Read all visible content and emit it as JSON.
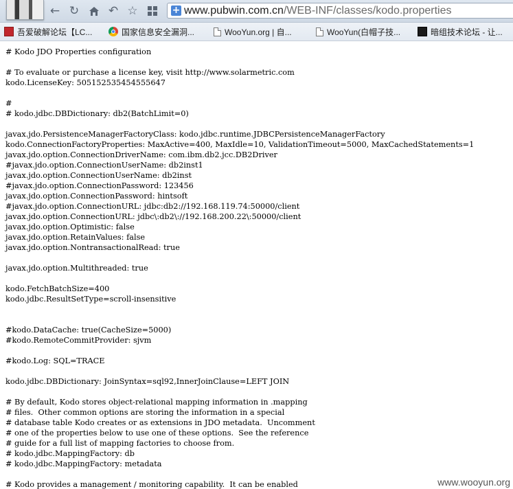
{
  "browser": {
    "address_bar": {
      "url_host": "www.pubwin.com.cn",
      "url_path": "/WEB-INF/classes/kodo.properties"
    },
    "bookmarks": [
      {
        "label": "吾爱破解论坛【LC...",
        "icon": "red-logo-icon"
      },
      {
        "label": "国家信息安全漏洞...",
        "icon": "chrome-icon"
      },
      {
        "label": "WooYun.org | 自...",
        "icon": "page-icon"
      },
      {
        "label": "WooYun(白帽子技...",
        "icon": "page-icon"
      },
      {
        "label": "暗组技术论坛 - 让...",
        "icon": "dark-logo-icon"
      }
    ]
  },
  "file_lines": [
    "# Kodo JDO Properties configuration",
    "",
    "# To evaluate or purchase a license key, visit http://www.solarmetric.com",
    "kodo.LicenseKey: 505152535454555647",
    "",
    "#",
    "# kodo.jdbc.DBDictionary: db2(BatchLimit=0)",
    "",
    "javax.jdo.PersistenceManagerFactoryClass: kodo.jdbc.runtime.JDBCPersistenceManagerFactory",
    "kodo.ConnectionFactoryProperties: MaxActive=400, MaxIdle=10, ValidationTimeout=5000, MaxCachedStatements=1",
    "javax.jdo.option.ConnectionDriverName: com.ibm.db2.jcc.DB2Driver",
    "#javax.jdo.option.ConnectionUserName: db2inst1",
    "javax.jdo.option.ConnectionUserName: db2inst",
    "#javax.jdo.option.ConnectionPassword: 123456",
    "javax.jdo.option.ConnectionPassword: hintsoft",
    "#javax.jdo.option.ConnectionURL: jdbc:db2://192.168.119.74:50000/client",
    "javax.jdo.option.ConnectionURL: jdbc\\:db2\\://192.168.200.22\\:50000/client",
    "javax.jdo.option.Optimistic: false",
    "javax.jdo.option.RetainValues: false",
    "javax.jdo.option.NontransactionalRead: true",
    "",
    "javax.jdo.option.Multithreaded: true",
    "",
    "kodo.FetchBatchSize=400",
    "kodo.jdbc.ResultSetType=scroll-insensitive",
    "",
    "",
    "#kodo.DataCache: true(CacheSize=5000)",
    "#kodo.RemoteCommitProvider: sjvm",
    "",
    "#kodo.Log: SQL=TRACE",
    "",
    "kodo.jdbc.DBDictionary: JoinSyntax=sql92,InnerJoinClause=LEFT JOIN",
    "",
    "# By default, Kodo stores object-relational mapping information in .mapping",
    "# files.  Other common options are storing the information in a special",
    "# database table Kodo creates or as extensions in JDO metadata.  Uncomment",
    "# one of the properties below to use one of these options.  See the reference",
    "# guide for a full list of mapping factories to choose from.",
    "# kodo.jdbc.MappingFactory: db",
    "# kodo.jdbc.MappingFactory: metadata",
    "",
    "# Kodo provides a management / monitoring capability.  It can be enabled"
  ],
  "watermark": "www.wooyun.org"
}
